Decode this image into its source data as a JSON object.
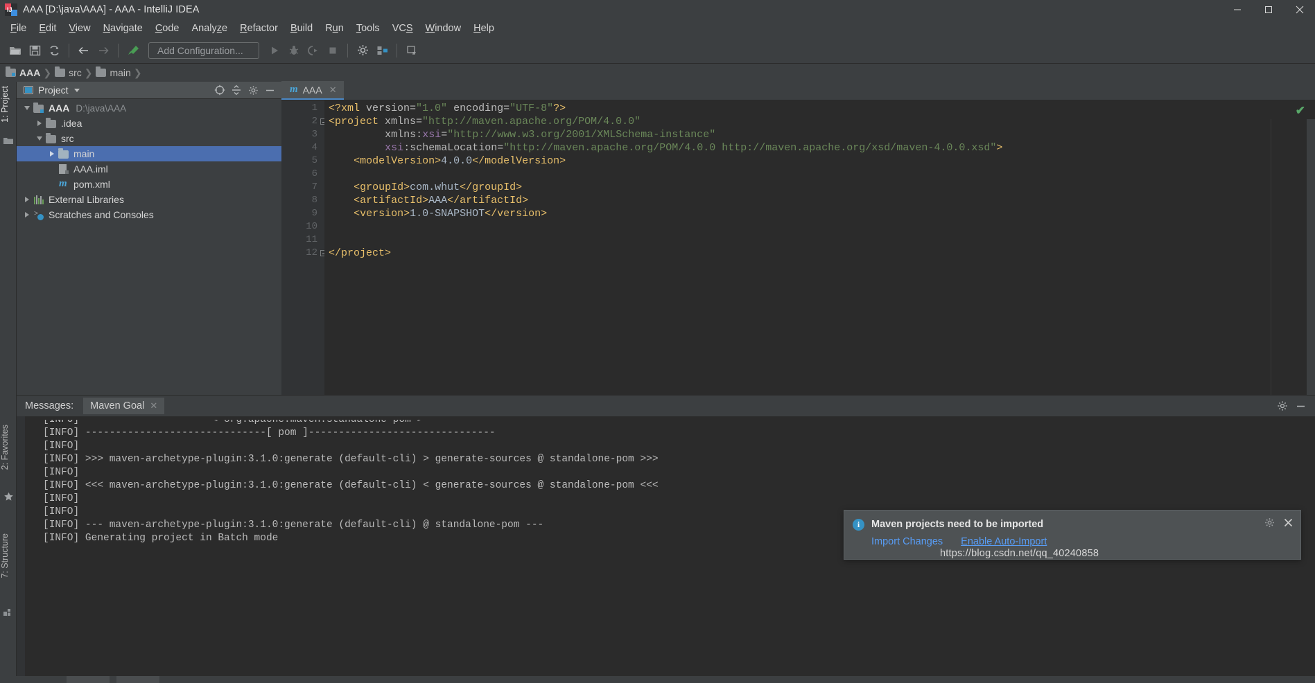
{
  "window": {
    "title": "AAA [D:\\java\\AAA] - AAA - IntelliJ IDEA",
    "minimize": "—",
    "maximize": "▢",
    "close": "✕"
  },
  "menu": {
    "items": [
      {
        "label": "File",
        "mnemonic": "F"
      },
      {
        "label": "Edit",
        "mnemonic": "E"
      },
      {
        "label": "View",
        "mnemonic": "V"
      },
      {
        "label": "Navigate",
        "mnemonic": "N"
      },
      {
        "label": "Code",
        "mnemonic": "C"
      },
      {
        "label": "Analyze",
        "mnemonic": "z"
      },
      {
        "label": "Refactor",
        "mnemonic": "R"
      },
      {
        "label": "Build",
        "mnemonic": "B"
      },
      {
        "label": "Run",
        "mnemonic": "u"
      },
      {
        "label": "Tools",
        "mnemonic": "T"
      },
      {
        "label": "VCS",
        "mnemonic": "S"
      },
      {
        "label": "Window",
        "mnemonic": "W"
      },
      {
        "label": "Help",
        "mnemonic": "H"
      }
    ]
  },
  "toolbar": {
    "run_config_label": "Add Configuration...",
    "buttons": [
      "open-icon",
      "save-icon",
      "sync-icon",
      "back-icon",
      "forward-icon",
      "build-icon",
      "run-icon",
      "debug-icon",
      "run-coverage-icon",
      "stop-icon",
      "settings-icon",
      "project-structure-icon",
      "update-icon"
    ]
  },
  "breadcrumb": {
    "items": [
      "AAA",
      "src",
      "main"
    ]
  },
  "left_strip": {
    "project_label": "1: Project",
    "favorites_label": "2: Favorites",
    "structure_label": "7: Structure"
  },
  "project_panel": {
    "title": "Project",
    "tree": [
      {
        "label": "AAA",
        "path": "D:\\java\\AAA",
        "depth": 0,
        "icon": "module-folder-icon",
        "state": "expanded",
        "bold": true,
        "selected": false
      },
      {
        "label": ".idea",
        "path": "",
        "depth": 1,
        "icon": "folder-icon",
        "state": "collapsed",
        "bold": false,
        "selected": false
      },
      {
        "label": "src",
        "path": "",
        "depth": 1,
        "icon": "folder-icon",
        "state": "expanded",
        "bold": false,
        "selected": false
      },
      {
        "label": "main",
        "path": "",
        "depth": 2,
        "icon": "folder-icon",
        "state": "collapsed",
        "bold": false,
        "selected": true
      },
      {
        "label": "AAA.iml",
        "path": "",
        "depth": 2,
        "icon": "iml-file-icon",
        "state": "leaf",
        "bold": false,
        "selected": false
      },
      {
        "label": "pom.xml",
        "path": "",
        "depth": 2,
        "icon": "maven-file-icon",
        "state": "leaf",
        "bold": false,
        "selected": false
      },
      {
        "label": "External Libraries",
        "path": "",
        "depth": 0,
        "icon": "libraries-icon",
        "state": "collapsed",
        "bold": false,
        "selected": false
      },
      {
        "label": "Scratches and Consoles",
        "path": "",
        "depth": 0,
        "icon": "scratches-icon",
        "state": "collapsed",
        "bold": false,
        "selected": false
      }
    ]
  },
  "editor": {
    "tab": {
      "label": "AAA",
      "icon": "maven-file-icon",
      "close": "✕"
    },
    "inspection_status": "✔",
    "lines": [
      {
        "n": "1",
        "indent": 0,
        "fold": false,
        "tokens": [
          {
            "t": "<?xml ",
            "c": "k-pi"
          },
          {
            "t": "version=",
            "c": "k-attr"
          },
          {
            "t": "\"1.0\"",
            "c": "k-str"
          },
          {
            "t": " ",
            "c": "k-txt"
          },
          {
            "t": "encoding=",
            "c": "k-attr"
          },
          {
            "t": "\"UTF-8\"",
            "c": "k-str"
          },
          {
            "t": "?>",
            "c": "k-pi"
          }
        ]
      },
      {
        "n": "2",
        "indent": 0,
        "fold": true,
        "tokens": [
          {
            "t": "<project ",
            "c": "k-tag"
          },
          {
            "t": "xmlns=",
            "c": "k-attr"
          },
          {
            "t": "\"http://maven.apache.org/POM/4.0.0\"",
            "c": "k-str"
          }
        ]
      },
      {
        "n": "3",
        "indent": 9,
        "fold": false,
        "tokens": [
          {
            "t": "xmlns:",
            "c": "k-attr"
          },
          {
            "t": "xsi",
            "c": "k-ns"
          },
          {
            "t": "=",
            "c": "k-attr"
          },
          {
            "t": "\"http://www.w3.org/2001/XMLSchema-instance\"",
            "c": "k-str"
          }
        ]
      },
      {
        "n": "4",
        "indent": 9,
        "fold": false,
        "tokens": [
          {
            "t": "xsi",
            "c": "k-ns"
          },
          {
            "t": ":schemaLocation=",
            "c": "k-attr"
          },
          {
            "t": "\"http://maven.apache.org/POM/4.0.0 http://maven.apache.org/xsd/maven-4.0.0.xsd\"",
            "c": "k-str"
          },
          {
            "t": ">",
            "c": "k-tag"
          }
        ]
      },
      {
        "n": "5",
        "indent": 4,
        "fold": false,
        "tokens": [
          {
            "t": "<modelVersion>",
            "c": "k-tag"
          },
          {
            "t": "4.0.0",
            "c": "k-txt"
          },
          {
            "t": "</modelVersion>",
            "c": "k-tag"
          }
        ]
      },
      {
        "n": "6",
        "indent": 0,
        "fold": false,
        "tokens": []
      },
      {
        "n": "7",
        "indent": 4,
        "fold": false,
        "tokens": [
          {
            "t": "<groupId>",
            "c": "k-tag"
          },
          {
            "t": "com.whut",
            "c": "k-txt"
          },
          {
            "t": "</groupId>",
            "c": "k-tag"
          }
        ]
      },
      {
        "n": "8",
        "indent": 4,
        "fold": false,
        "tokens": [
          {
            "t": "<artifactId>",
            "c": "k-tag"
          },
          {
            "t": "AAA",
            "c": "k-txt"
          },
          {
            "t": "</artifactId>",
            "c": "k-tag"
          }
        ]
      },
      {
        "n": "9",
        "indent": 4,
        "fold": false,
        "tokens": [
          {
            "t": "<version>",
            "c": "k-tag"
          },
          {
            "t": "1.0-SNAPSHOT",
            "c": "k-txt"
          },
          {
            "t": "</version>",
            "c": "k-tag"
          }
        ]
      },
      {
        "n": "10",
        "indent": 0,
        "fold": false,
        "tokens": []
      },
      {
        "n": "11",
        "indent": 0,
        "fold": false,
        "tokens": []
      },
      {
        "n": "12",
        "indent": 0,
        "fold": true,
        "tokens": [
          {
            "t": "</project>",
            "c": "k-tag"
          }
        ]
      }
    ]
  },
  "messages_panel": {
    "label": "Messages:",
    "tab": {
      "label": "Maven Goal",
      "close": "✕"
    },
    "console_lines": [
      "[INFO] ------------------------------[ pom ]-------------------------------",
      "[INFO] ",
      "[INFO] >>> maven-archetype-plugin:3.1.0:generate (default-cli) > generate-sources @ standalone-pom >>>",
      "[INFO] ",
      "[INFO] <<< maven-archetype-plugin:3.1.0:generate (default-cli) < generate-sources @ standalone-pom <<<",
      "[INFO] ",
      "[INFO] ",
      "[INFO] --- maven-archetype-plugin:3.1.0:generate (default-cli) @ standalone-pom ---",
      "[INFO] Generating project in Batch mode"
    ],
    "clipped_top_line": "[INFO] ---------------------< org.apache.maven:standalone-pom >---------------------"
  },
  "notification": {
    "icon": "info-icon",
    "title": "Maven projects need to be imported",
    "primary_action": "Import Changes",
    "secondary_action": "Enable Auto-Import",
    "settings_icon": "gear-icon",
    "close_icon": "close-icon"
  },
  "watermark": {
    "text": "https://blog.csdn.net/qq_40240858"
  },
  "colors": {
    "accent_blue": "#3592c4",
    "selection_blue": "#4b6eaf",
    "tab_underline": "#4a88c7",
    "link_blue": "#589df6",
    "string_green": "#6a8759",
    "tag_orange": "#e8bf6a",
    "ns_purple": "#9876aa",
    "ok_green": "#59a869",
    "panel_bg": "#3c3f41",
    "editor_bg": "#2b2b2b",
    "gutter_bg": "#313335"
  }
}
